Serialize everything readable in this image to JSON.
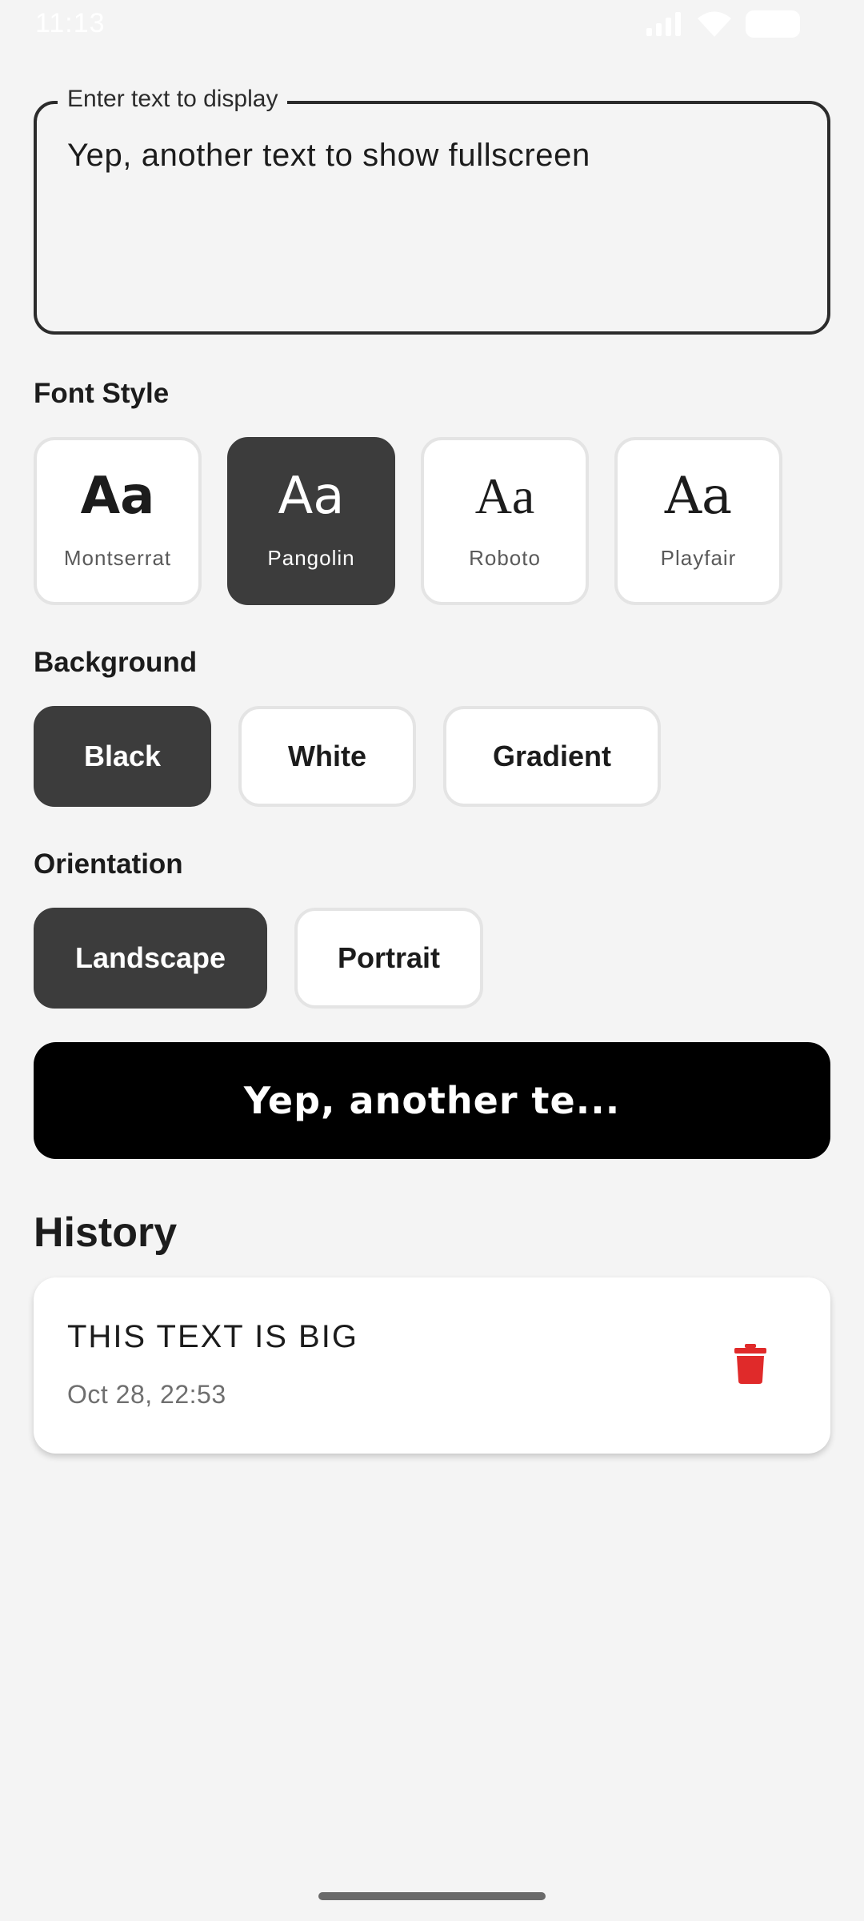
{
  "status_bar": {
    "time": "11:13",
    "icons": [
      "signal-icon",
      "wifi-icon",
      "battery-icon"
    ]
  },
  "text_input": {
    "label": "Enter text to display",
    "value": "Yep, another text to show fullscreen"
  },
  "font_style": {
    "title": "Font Style",
    "options": [
      {
        "sample": "Aa",
        "name": "Montserrat",
        "selected": false
      },
      {
        "sample": "Aa",
        "name": "Pangolin",
        "selected": true
      },
      {
        "sample": "Aa",
        "name": "Roboto",
        "selected": false
      },
      {
        "sample": "Aa",
        "name": "Playfair",
        "selected": false
      }
    ]
  },
  "background": {
    "title": "Background",
    "options": [
      {
        "label": "Black",
        "selected": true
      },
      {
        "label": "White",
        "selected": false
      },
      {
        "label": "Gradient",
        "selected": false
      }
    ]
  },
  "orientation": {
    "title": "Orientation",
    "options": [
      {
        "label": "Landscape",
        "selected": true
      },
      {
        "label": "Portrait",
        "selected": false
      }
    ]
  },
  "preview_button": {
    "label": "Yep, another te..."
  },
  "history": {
    "title": "History",
    "items": [
      {
        "text": "THIS TEXT IS BIG",
        "date": "Oct 28, 22:53"
      }
    ]
  },
  "colors": {
    "selected_bg": "#3c3c3c",
    "preview_bg": "#000000",
    "delete_red": "#e02a2a",
    "page_bg": "#f4f4f4"
  }
}
